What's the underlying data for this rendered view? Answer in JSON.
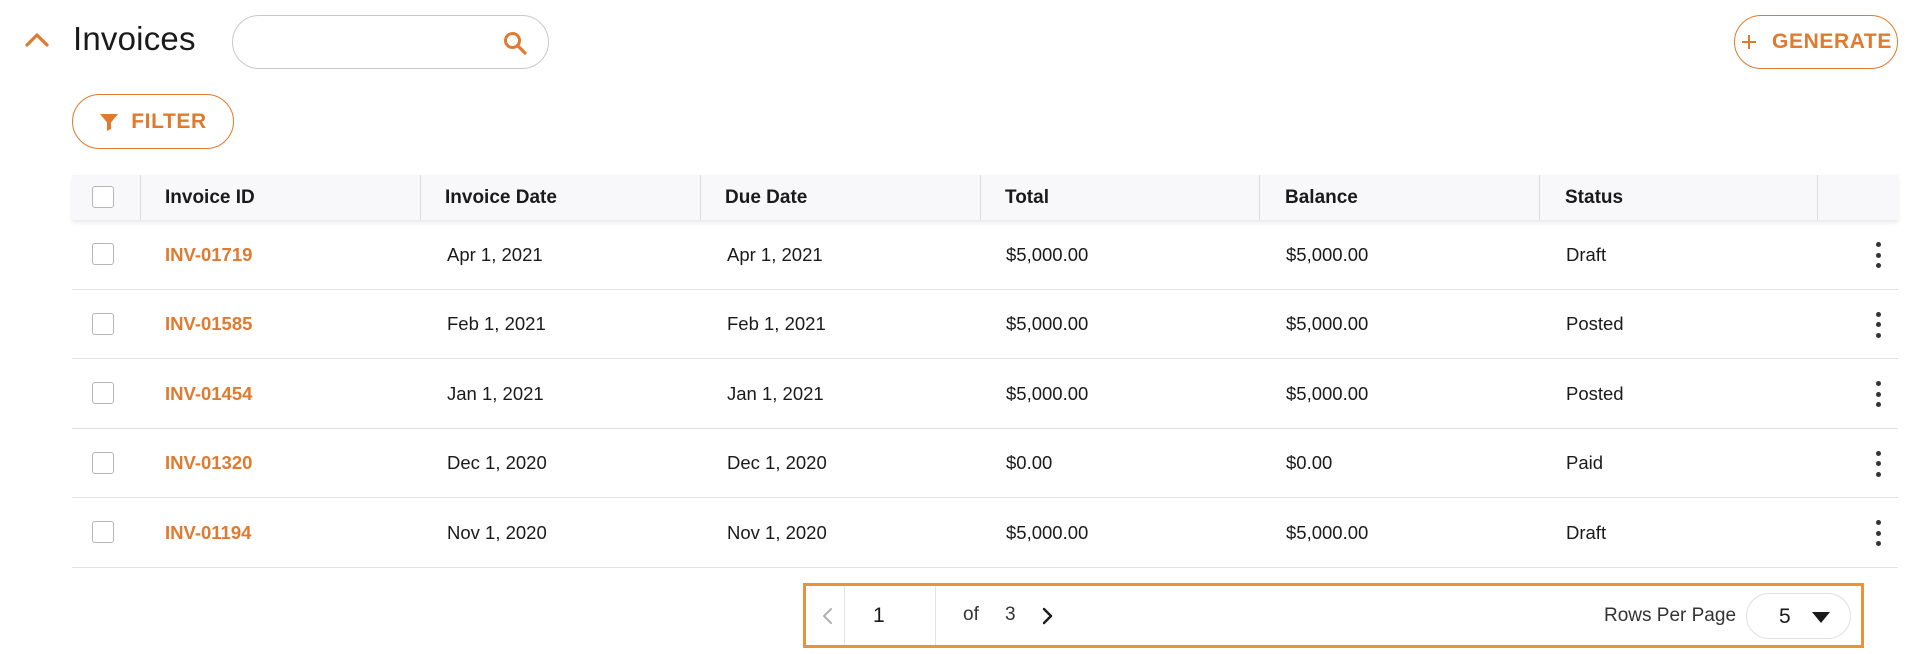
{
  "header": {
    "title": "Invoices",
    "search": {
      "value": "",
      "placeholder": ""
    },
    "generate_label": "GENERATE"
  },
  "toolbar": {
    "filter_label": "FILTER"
  },
  "colors": {
    "accent": "#e07a2f",
    "pager_highlight": "#e8923a"
  },
  "icons": {
    "collapse": "chevron-up-icon",
    "search": "search-icon",
    "generate": "plus-icon",
    "filter": "funnel-icon",
    "row_menu": "kebab-menu-icon",
    "prev": "chevron-left-icon",
    "next": "chevron-right-icon",
    "rows_dropdown": "caret-down-icon"
  },
  "table": {
    "columns": [
      "Invoice ID",
      "Invoice Date",
      "Due Date",
      "Total",
      "Balance",
      "Status"
    ],
    "rows": [
      {
        "id": "INV-01719",
        "invoice_date": "Apr 1, 2021",
        "due_date": "Apr 1, 2021",
        "total": "$5,000.00",
        "balance": "$5,000.00",
        "status": "Draft"
      },
      {
        "id": "INV-01585",
        "invoice_date": "Feb 1, 2021",
        "due_date": "Feb 1, 2021",
        "total": "$5,000.00",
        "balance": "$5,000.00",
        "status": "Posted"
      },
      {
        "id": "INV-01454",
        "invoice_date": "Jan 1, 2021",
        "due_date": "Jan 1, 2021",
        "total": "$5,000.00",
        "balance": "$5,000.00",
        "status": "Posted"
      },
      {
        "id": "INV-01320",
        "invoice_date": "Dec 1, 2020",
        "due_date": "Dec 1, 2020",
        "total": "$0.00",
        "balance": "$0.00",
        "status": "Paid"
      },
      {
        "id": "INV-01194",
        "invoice_date": "Nov 1, 2020",
        "due_date": "Nov 1, 2020",
        "total": "$5,000.00",
        "balance": "$5,000.00",
        "status": "Draft"
      }
    ]
  },
  "pagination": {
    "current_page": "1",
    "of_label": "of",
    "total_pages": "3",
    "rows_per_page_label": "Rows Per Page",
    "rows_per_page": "5"
  }
}
